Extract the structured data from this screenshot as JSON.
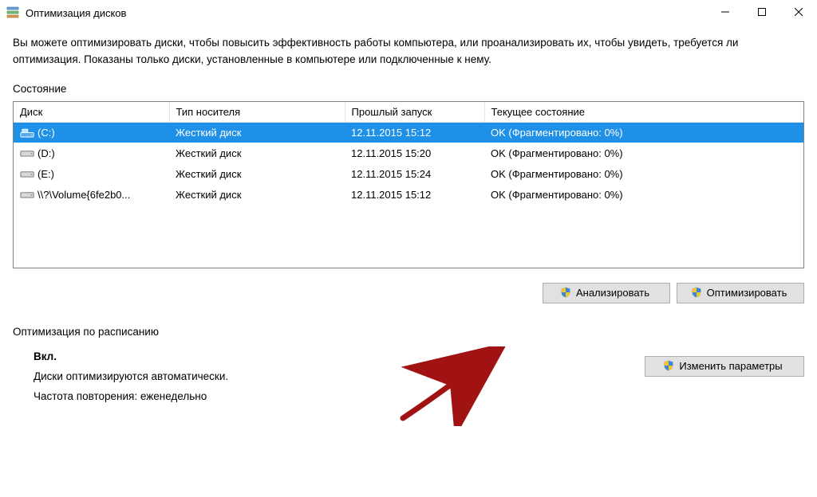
{
  "window": {
    "title": "Оптимизация дисков"
  },
  "intro": "Вы можете оптимизировать диски, чтобы повысить эффективность работы  компьютера, или проанализировать их, чтобы увидеть, требуется ли оптимизация. Показаны только диски, установленные в компьютере или подключенные к нему.",
  "status_label": "Состояние",
  "table": {
    "headers": {
      "disk": "Диск",
      "media": "Тип носителя",
      "last_run": "Прошлый запуск",
      "state": "Текущее состояние"
    },
    "rows": [
      {
        "selected": true,
        "icon": "system-drive",
        "disk": "(C:)",
        "media": "Жесткий диск",
        "last_run": "12.11.2015 15:12",
        "state": "OK (Фрагментировано: 0%)"
      },
      {
        "selected": false,
        "icon": "drive",
        "disk": "(D:)",
        "media": "Жесткий диск",
        "last_run": "12.11.2015 15:20",
        "state": "OK (Фрагментировано: 0%)"
      },
      {
        "selected": false,
        "icon": "drive",
        "disk": "(E:)",
        "media": "Жесткий диск",
        "last_run": "12.11.2015 15:24",
        "state": "OK (Фрагментировано: 0%)"
      },
      {
        "selected": false,
        "icon": "drive",
        "disk": "\\\\?\\Volume{6fe2b0...",
        "media": "Жесткий диск",
        "last_run": "12.11.2015 15:12",
        "state": "OK (Фрагментировано: 0%)"
      }
    ]
  },
  "buttons": {
    "analyze": "Анализировать",
    "optimize": "Оптимизировать",
    "change_settings": "Изменить параметры"
  },
  "schedule": {
    "title": "Оптимизация по расписанию",
    "on": "Вкл.",
    "auto_line": "Диски оптимизируются автоматически.",
    "freq_line": "Частота повторения: еженедельно"
  }
}
